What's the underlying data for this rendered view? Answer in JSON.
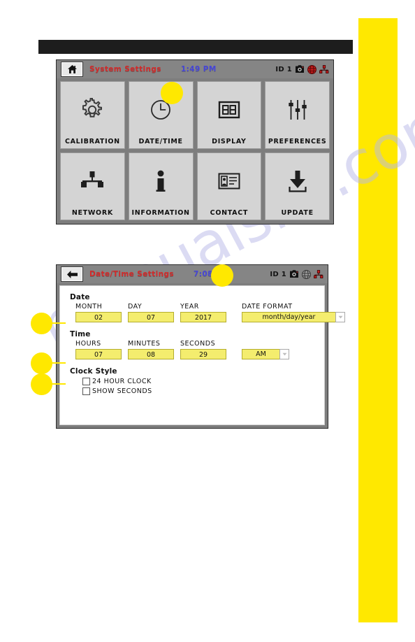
{
  "page": {
    "watermark": "manualslib.com",
    "accent_yellow": "#ffe800",
    "input_yellow": "#f4ed6e",
    "title_red": "#d42a2a",
    "clock_blue": "#4646d8"
  },
  "panel_system": {
    "header": {
      "nav_icon": "home-icon",
      "title": "System Settings",
      "clock": "1:49 PM",
      "status_id": "ID 1",
      "status_icons": [
        "camera-icon",
        "globe-icon",
        "network-icon"
      ]
    },
    "tiles": [
      {
        "label": "CALIBRATION",
        "icon": "gear-icon"
      },
      {
        "label": "DATE/TIME",
        "icon": "clock-icon"
      },
      {
        "label": "DISPLAY",
        "icon": "display-icon"
      },
      {
        "label": "PREFERENCES",
        "icon": "sliders-icon"
      },
      {
        "label": "NETWORK",
        "icon": "network-icon"
      },
      {
        "label": "INFORMATION",
        "icon": "info-icon"
      },
      {
        "label": "CONTACT",
        "icon": "contact-card-icon"
      },
      {
        "label": "UPDATE",
        "icon": "download-icon"
      }
    ]
  },
  "panel_datetime": {
    "header": {
      "nav_icon": "back-arrow-icon",
      "title": "Date/Time Settings",
      "clock": "7:08 AM",
      "status_id": "ID 1",
      "status_icons": [
        "camera-icon",
        "globe-icon",
        "network-icon"
      ]
    },
    "date_group": {
      "title": "Date",
      "fields": [
        {
          "label": "MONTH",
          "value": "02"
        },
        {
          "label": "DAY",
          "value": "07"
        },
        {
          "label": "YEAR",
          "value": "2017"
        }
      ],
      "format": {
        "label": "DATE FORMAT",
        "value": "month/day/year",
        "arrow_icon": "chevron-down-icon"
      }
    },
    "time_group": {
      "title": "Time",
      "fields": [
        {
          "label": "HOURS",
          "value": "07"
        },
        {
          "label": "MINUTES",
          "value": "08"
        },
        {
          "label": "SECONDS",
          "value": "29"
        }
      ],
      "meridiem": {
        "value": "AM",
        "arrow_icon": "chevron-down-icon"
      }
    },
    "clock_style": {
      "title": "Clock Style",
      "options": [
        {
          "label": "24 HOUR CLOCK",
          "checked": false
        },
        {
          "label": "SHOW SECONDS",
          "checked": false
        }
      ]
    }
  }
}
